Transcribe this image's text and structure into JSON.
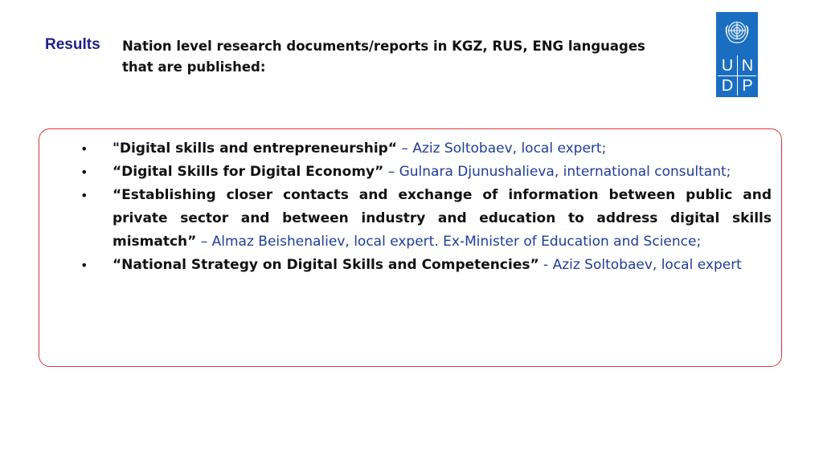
{
  "header": {
    "label": "Results",
    "heading": "Nation level research documents/reports in KGZ, RUS, ENG languages that are published:"
  },
  "logo": {
    "letters": [
      "U",
      "N",
      "D",
      "P"
    ],
    "color": "#1a6ec2"
  },
  "colors": {
    "title_text": "#111111",
    "author_text": "#1f3d99",
    "results_label": "#1f1f8a",
    "box_border": "#d9363e"
  },
  "items": [
    {
      "bullet": "•",
      "title": "\"Digital skills and entrepreneurship“",
      "author": " – Aziz Soltobaev, local expert;"
    },
    {
      "bullet": "•",
      "title": "“Digital Skills for Digital Economy”",
      "author": " – Gulnara Djunushalieva, international consultant;"
    },
    {
      "bullet": "•",
      "title": "“Establishing closer contacts and exchange of information between public and private sector and between industry and education to address digital skills mismatch”",
      "author": " – Almaz Beishenaliev, local expert. Ex-Minister of Education and Science;"
    },
    {
      "bullet": "•",
      "title": "“National Strategy on Digital Skills and Competencies”",
      "author": " - Aziz Soltobaev, local expert"
    }
  ]
}
